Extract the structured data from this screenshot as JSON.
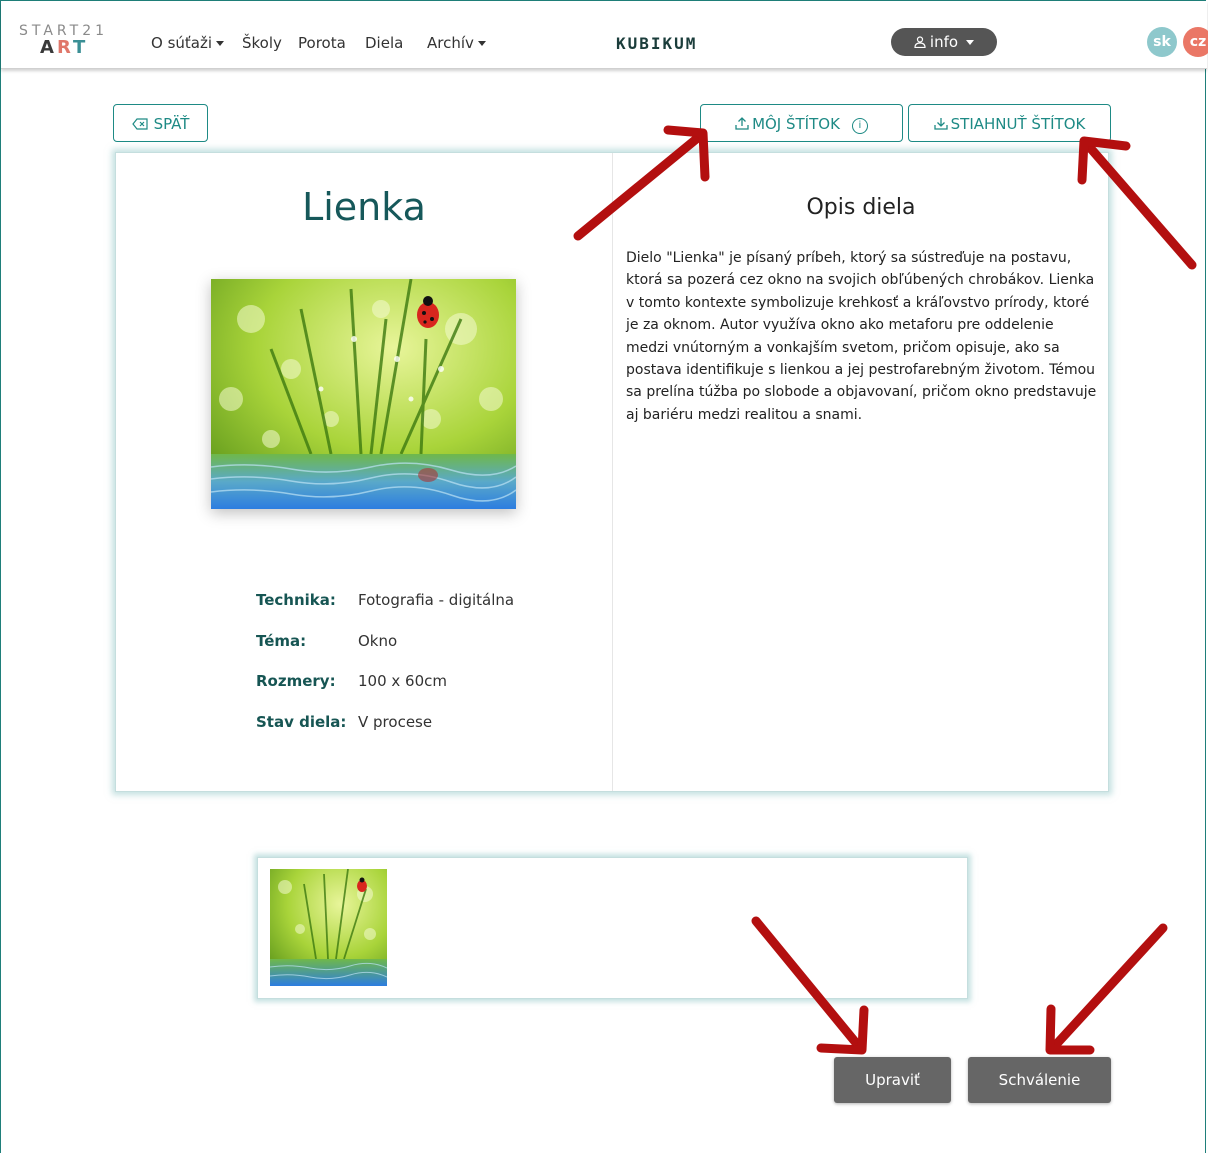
{
  "navbar": {
    "logo_top": "START21",
    "logo_bottom": [
      "A",
      "R",
      "T"
    ],
    "menu": [
      {
        "label": "O súťaži",
        "dropdown": true
      },
      {
        "label": "Školy",
        "dropdown": false
      },
      {
        "label": "Porota",
        "dropdown": false
      },
      {
        "label": "Diela",
        "dropdown": false
      },
      {
        "label": "Archív",
        "dropdown": true
      }
    ],
    "brand": "KUBIKUM",
    "user_menu": "info",
    "languages": [
      "sk",
      "cz"
    ]
  },
  "toolbar": {
    "back_label": "SPÄŤ",
    "my_label": "MÔJ ŠTÍTOK",
    "download_label": "STIAHNUŤ ŠTÍTOK"
  },
  "work": {
    "title": "Lienka",
    "details": [
      {
        "key": "Technika:",
        "value": "Fotografia - digitálna"
      },
      {
        "key": "Téma:",
        "value": "Okno"
      },
      {
        "key": "Rozmery:",
        "value": "100 x 60cm"
      },
      {
        "key": "Stav diela:",
        "value": "V procese"
      }
    ],
    "description_title": "Opis diela",
    "description": "Dielo \"Lienka\" je písaný príbeh, ktorý sa sústreďuje na postavu, ktorá sa pozerá cez okno na svojich obľúbených chrobákov. Lienka v tomto kontexte symbolizuje krehkosť a kráľovstvo prírody, ktoré je za oknom. Autor využíva okno ako metaforu pre oddelenie medzi vnútorným a vonkajším svetom, pričom opisuje, ako sa postava identifikuje s lienkou a jej pestrofarebným životom. Témou sa prelína túžba po slobode a objavovaní, pričom okno predstavuje aj bariéru medzi realitou a snami."
  },
  "actions": {
    "edit_label": "Upraviť",
    "approve_label": "Schválenie"
  },
  "colors": {
    "accent": "#1e8a85",
    "dark_teal": "#16585a",
    "button_gray": "#666666",
    "arrow_red": "#b30f0f"
  }
}
